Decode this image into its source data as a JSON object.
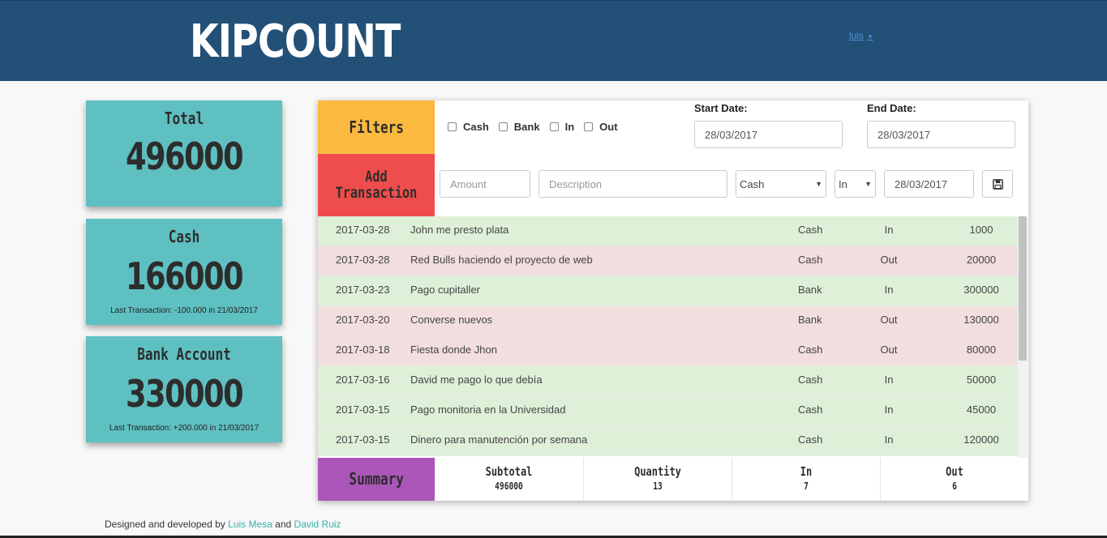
{
  "header": {
    "logo": "KIPCOUNT",
    "user": "luis",
    "user_caret": "▼"
  },
  "cards": {
    "total": {
      "title": "Total",
      "value": "496000"
    },
    "cash": {
      "title": "Cash",
      "value": "166000",
      "note": "Last Transaction: -100.000 in 21/03/2017"
    },
    "bank": {
      "title": "Bank Account",
      "value": "330000",
      "note": "Last Transaction: +200.000 in 21/03/2017"
    }
  },
  "filters": {
    "label": "Filters",
    "options": [
      "Cash",
      "Bank",
      "In",
      "Out"
    ],
    "start_label": "Start Date:",
    "start_value": "28/03/2017",
    "end_label": "End Date:",
    "end_value": "28/03/2017"
  },
  "add": {
    "label_line1": "Add",
    "label_line2": "Transaction",
    "amount_placeholder": "Amount",
    "description_placeholder": "Description",
    "source_value": "Cash",
    "direction_value": "In",
    "date_value": "28/03/2017",
    "save_icon": "floppy-disk-icon"
  },
  "transactions": [
    {
      "date": "2017-03-28",
      "description": "John me presto plata",
      "source": "Cash",
      "direction": "In",
      "amount": "1000"
    },
    {
      "date": "2017-03-28",
      "description": "Red Bulls haciendo el proyecto de web",
      "source": "Cash",
      "direction": "Out",
      "amount": "20000"
    },
    {
      "date": "2017-03-23",
      "description": "Pago cupitaller",
      "source": "Bank",
      "direction": "In",
      "amount": "300000"
    },
    {
      "date": "2017-03-20",
      "description": "Converse nuevos",
      "source": "Bank",
      "direction": "Out",
      "amount": "130000"
    },
    {
      "date": "2017-03-18",
      "description": "Fiesta donde Jhon",
      "source": "Cash",
      "direction": "Out",
      "amount": "80000"
    },
    {
      "date": "2017-03-16",
      "description": "David me pago lo que debía",
      "source": "Cash",
      "direction": "In",
      "amount": "50000"
    },
    {
      "date": "2017-03-15",
      "description": "Pago monitoria en la Universidad",
      "source": "Cash",
      "direction": "In",
      "amount": "45000"
    },
    {
      "date": "2017-03-15",
      "description": "Dinero para manutención por semana",
      "source": "Cash",
      "direction": "In",
      "amount": "120000"
    }
  ],
  "summary": {
    "label": "Summary",
    "subtotal_label": "Subtotal",
    "subtotal_value": "496000",
    "quantity_label": "Quantity",
    "quantity_value": "13",
    "in_label": "In",
    "in_value": "7",
    "out_label": "Out",
    "out_value": "6"
  },
  "footer": {
    "prefix": "Designed and developed by ",
    "author1": "Luis Mesa",
    "joiner": " and ",
    "author2": "David Ruiz"
  },
  "colors": {
    "header": "#235077",
    "card": "#5fc0c1",
    "filters": "#fbb940",
    "add": "#ef4d4b",
    "summary": "#ab56b9",
    "row_in": "#dff0d8",
    "row_out": "#f2dede",
    "link": "#36b3a8"
  }
}
